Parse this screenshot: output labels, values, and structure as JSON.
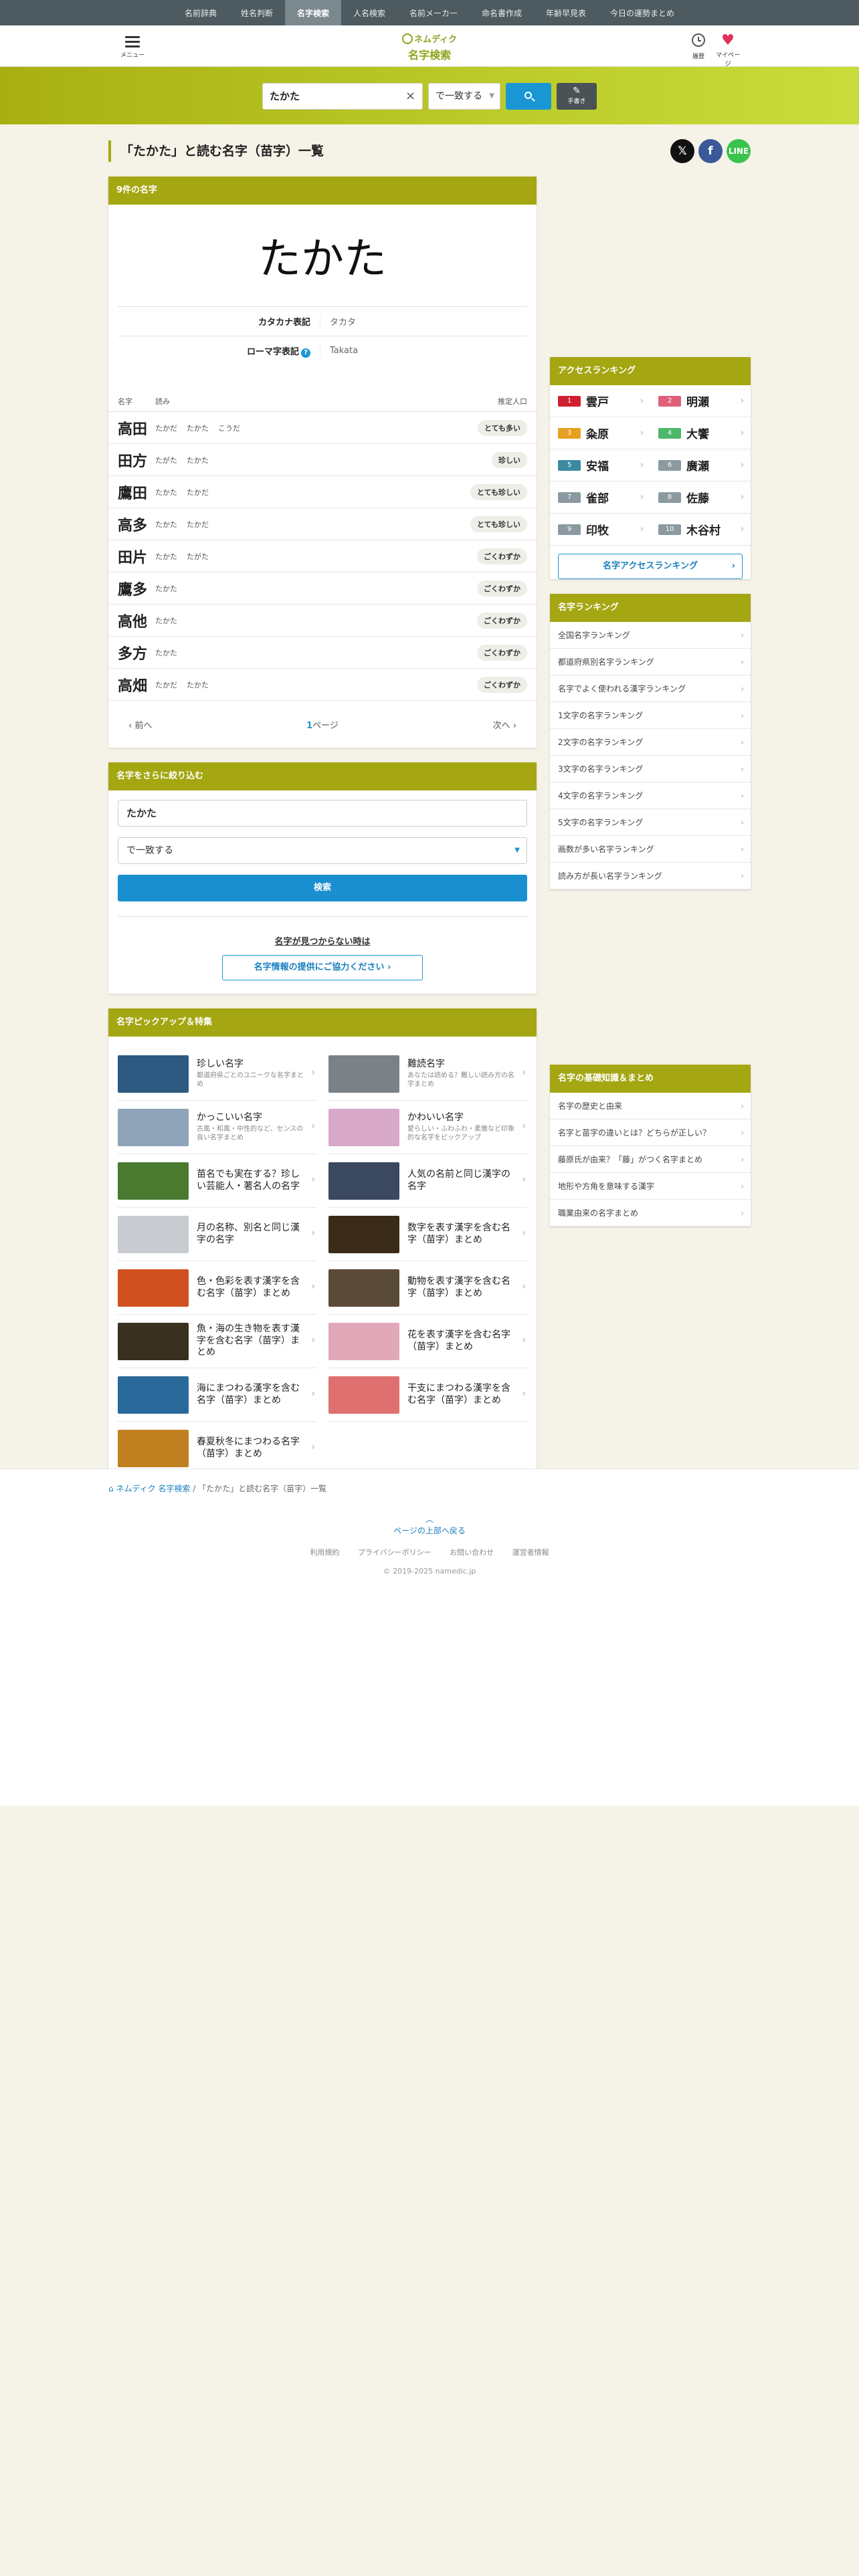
{
  "topnav": [
    "名前辞典",
    "姓名判断",
    "名字検索",
    "人名検索",
    "名前メーカー",
    "命名書作成",
    "年齢早見表",
    "今日の運勢まとめ"
  ],
  "header": {
    "menu_label": "メニュー",
    "logo_top": "ネムディク",
    "logo_bottom": "名字検索",
    "history_label": "履歴",
    "mypage_label": "マイページ"
  },
  "search": {
    "value": "たかた",
    "match_mode": "で一致する",
    "handwrite_label": "手書き"
  },
  "page_title": "「たかた」と読む名字（苗字）一覧",
  "results": {
    "header": "9件の名字",
    "big_name": "たかた",
    "katakana_label": "カタカナ表記",
    "katakana_value": "タカタ",
    "romaji_label": "ローマ字表記",
    "romaji_value": "Takata",
    "col_name": "名字",
    "col_reading": "読み",
    "col_pop": "推定人口",
    "rows": [
      {
        "name": "高田",
        "readings": [
          "たかだ",
          "たかた",
          "こうだ"
        ],
        "pop": "とても多い"
      },
      {
        "name": "田方",
        "readings": [
          "たがた",
          "たかた"
        ],
        "pop": "珍しい"
      },
      {
        "name": "鷹田",
        "readings": [
          "たかた",
          "たかだ"
        ],
        "pop": "とても珍しい"
      },
      {
        "name": "高多",
        "readings": [
          "たかた",
          "たかだ"
        ],
        "pop": "とても珍しい"
      },
      {
        "name": "田片",
        "readings": [
          "たかた",
          "たがた"
        ],
        "pop": "ごくわずか"
      },
      {
        "name": "鷹多",
        "readings": [
          "たかた"
        ],
        "pop": "ごくわずか"
      },
      {
        "name": "高他",
        "readings": [
          "たかた"
        ],
        "pop": "ごくわずか"
      },
      {
        "name": "多方",
        "readings": [
          "たかた"
        ],
        "pop": "ごくわずか"
      },
      {
        "name": "高畑",
        "readings": [
          "たかだ",
          "たかた"
        ],
        "pop": "ごくわずか"
      }
    ],
    "prev": "前へ",
    "page_num": "1",
    "page_suffix": "ページ",
    "next": "次へ"
  },
  "refine": {
    "header": "名字をさらに絞り込む",
    "value": "たかた",
    "mode": "で一致する",
    "button": "検索",
    "not_found": "名字が見つからない時は",
    "contribute": "名字情報の提供にご協力ください"
  },
  "pickup": {
    "header": "名字ピックアップ＆特集",
    "items": [
      {
        "title": "珍しい名字",
        "desc": "都道府県ごとのユニークな名字まとめ",
        "color": "#2c5a80"
      },
      {
        "title": "難読名字",
        "desc": "あなたは読める？難しい読み方の名字まとめ",
        "color": "#7a8288"
      },
      {
        "title": "かっこいい名字",
        "desc": "古風・和風・中性的など、センスの良い名字まとめ",
        "color": "#8fa4b8"
      },
      {
        "title": "かわいい名字",
        "desc": "愛らしい・ふわふわ・柔雅など印象的な名字をピックアップ",
        "color": "#d8a8c8"
      },
      {
        "title": "苗名でも実在する？珍しい芸能人・著名人の名字",
        "desc": "",
        "color": "#4a7a30"
      },
      {
        "title": "人気の名前と同じ漢字の名字",
        "desc": "",
        "color": "#3a4860"
      },
      {
        "title": "月の名称、別名と同じ漢字の名字",
        "desc": "",
        "color": "#c8ccd0"
      },
      {
        "title": "数字を表す漢字を含む名字（苗字）まとめ",
        "desc": "",
        "color": "#3a2a18"
      },
      {
        "title": "色・色彩を表す漢字を含む名字（苗字）まとめ",
        "desc": "",
        "color": "#d05020"
      },
      {
        "title": "動物を表す漢字を含む名字（苗字）まとめ",
        "desc": "",
        "color": "#5a4a38"
      },
      {
        "title": "魚・海の生き物を表す漢字を含む名字（苗字）まとめ",
        "desc": "",
        "color": "#3a3020"
      },
      {
        "title": "花を表す漢字を含む名字（苗字）まとめ",
        "desc": "",
        "color": "#e0a8b8"
      },
      {
        "title": "海にまつわる漢字を含む名字（苗字）まとめ",
        "desc": "",
        "color": "#2a6a9a"
      },
      {
        "title": "干支にまつわる漢字を含む名字（苗字）まとめ",
        "desc": "",
        "color": "#e07070"
      },
      {
        "title": "春夏秋冬にまつわる名字（苗字）まとめ",
        "desc": "",
        "color": "#c08020"
      }
    ]
  },
  "ranking": {
    "header": "アクセスランキング",
    "items": [
      {
        "n": "1",
        "name": "雲戸",
        "color": "#d02030"
      },
      {
        "n": "2",
        "name": "明瀬",
        "color": "#e0607a"
      },
      {
        "n": "3",
        "name": "粂原",
        "color": "#e8a020"
      },
      {
        "n": "4",
        "name": "大饗",
        "color": "#4cb86a"
      },
      {
        "n": "5",
        "name": "安福",
        "color": "#3a8aa0"
      },
      {
        "n": "6",
        "name": "廣瀬",
        "color": "#8a9aa0"
      },
      {
        "n": "7",
        "name": "雀部",
        "color": "#8a9aa0"
      },
      {
        "n": "8",
        "name": "佐藤",
        "color": "#8a9aa0"
      },
      {
        "n": "9",
        "name": "印牧",
        "color": "#8a9aa0"
      },
      {
        "n": "10",
        "name": "木谷村",
        "color": "#8a9aa0"
      }
    ],
    "button": "名字アクセスランキング"
  },
  "name_ranking": {
    "header": "名字ランキング",
    "items": [
      "全国名字ランキング",
      "都道府県別名字ランキング",
      "名字でよく使われる漢字ランキング",
      "1文字の名字ランキング",
      "2文字の名字ランキング",
      "3文字の名字ランキング",
      "4文字の名字ランキング",
      "5文字の名字ランキング",
      "画数が多い名字ランキング",
      "読み方が長い名字ランキング"
    ]
  },
  "basics": {
    "header": "名字の基礎知識＆まとめ",
    "items": [
      "名字の歴史と由来",
      "名字と苗字の違いとは？どちらが正しい？",
      "藤原氏が由来？「藤」がつく名字まとめ",
      "地形や方角を意味する漢字",
      "職業由来の名字まとめ"
    ]
  },
  "footer": {
    "crumb_home": "ネムディク 名字検索",
    "crumb_current": "「たかた」と読む名字（苗字）一覧",
    "to_top": "ページの上部へ戻る",
    "links": [
      "利用規約",
      "プライバシーポリシー",
      "お問い合わせ",
      "運営者情報"
    ],
    "copyright": "© 2019-2025 namedic.jp"
  }
}
